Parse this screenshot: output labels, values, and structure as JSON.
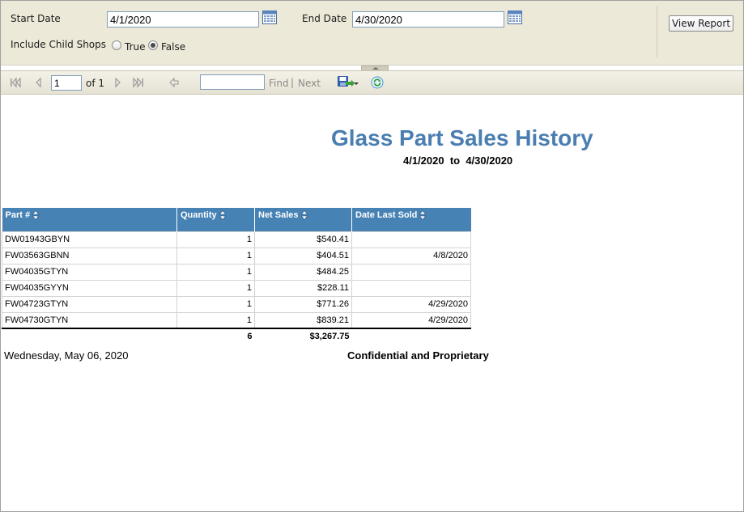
{
  "params": {
    "start_date_label": "Start Date",
    "start_date_value": "4/1/2020",
    "end_date_label": "End Date",
    "end_date_value": "4/30/2020",
    "include_child_label": "Include Child Shops",
    "option_true": "True",
    "option_false": "False",
    "selected_option": "False",
    "view_report_label": "View Report"
  },
  "toolbar": {
    "page_value": "1",
    "of_text": "of 1",
    "find_label": "Find",
    "separator": "|",
    "next_label": "Next"
  },
  "report": {
    "title": "Glass Part Sales History",
    "date_range": "4/1/2020  to  4/30/2020",
    "columns": [
      "Part #",
      "Quantity",
      "Net Sales",
      "Date Last Sold"
    ],
    "rows": [
      {
        "part": "DW01943GBYN",
        "qty": "1",
        "sales": "$540.41",
        "date": ""
      },
      {
        "part": "FW03563GBNN",
        "qty": "1",
        "sales": "$404.51",
        "date": "4/8/2020"
      },
      {
        "part": "FW04035GTYN",
        "qty": "1",
        "sales": "$484.25",
        "date": ""
      },
      {
        "part": "FW04035GYYN",
        "qty": "1",
        "sales": "$228.11",
        "date": ""
      },
      {
        "part": "FW04723GTYN",
        "qty": "1",
        "sales": "$771.26",
        "date": "4/29/2020"
      },
      {
        "part": "FW04730GTYN",
        "qty": "1",
        "sales": "$839.21",
        "date": "4/29/2020"
      }
    ],
    "total_qty": "6",
    "total_sales": "$3,267.75",
    "footer_date": "Wednesday, May 06, 2020",
    "footer_confidential": "Confidential and Proprietary"
  },
  "colors": {
    "header_blue": "#4682b4",
    "title_blue": "#4a7eb0",
    "param_bg": "#ece9d8"
  }
}
